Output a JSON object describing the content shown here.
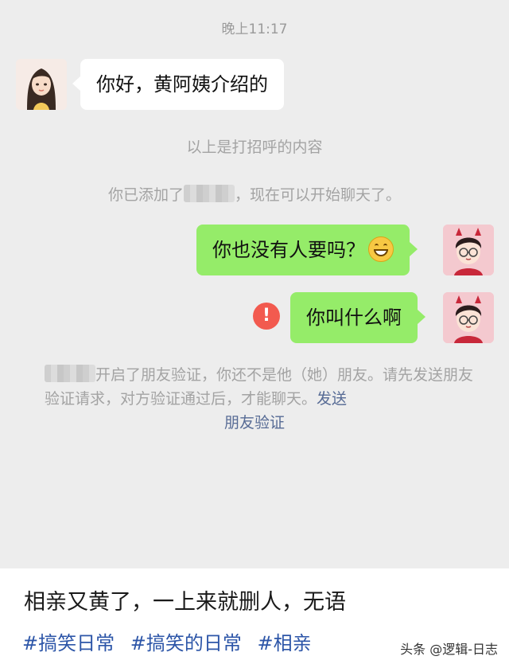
{
  "chat": {
    "timestamp": "晚上11:17",
    "messages": [
      {
        "side": "in",
        "text": "你好，黄阿姨介绍的"
      },
      {
        "side": "out",
        "text": "你也没有人要吗？",
        "emoji": "grinning-face-emoji"
      },
      {
        "side": "out",
        "text": "你叫什么啊",
        "status": "failed"
      }
    ],
    "system_greeting": "以上是打招呼的内容",
    "system_added_prefix": "你已添加了",
    "system_added_suffix": "，现在可以开始聊天了。",
    "notice_text": "开启了朋友验证，你还不是他（她）朋友。请先发送朋友验证请求，对方验证通过后，才能聊天。",
    "notice_link_part1": "发送",
    "notice_link_part2": "朋友验证",
    "colors": {
      "bubble_in": "#ffffff",
      "bubble_out": "#95ec69",
      "error": "#f25a4f",
      "link": "#576b95"
    }
  },
  "post": {
    "title": "相亲又黄了，一上来就删人，无语",
    "tags": [
      "#搞笑日常",
      "#搞笑的日常",
      "#相亲"
    ],
    "watermark": "头条 @逻辑-日志"
  }
}
